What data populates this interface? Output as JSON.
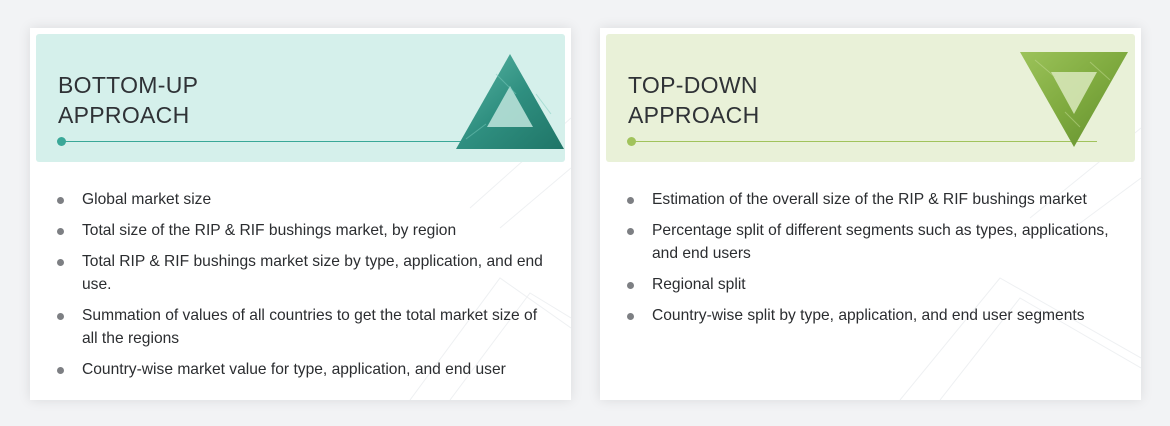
{
  "cards": [
    {
      "id": "bottom-up",
      "title": "BOTTOM-UP\nAPPROACH",
      "accent": "#3aa898",
      "header_bg": "#d5f0eb",
      "icon": "triangle-up-icon",
      "items": [
        "Global market size",
        "Total size of the RIP & RIF bushings market, by region",
        "Total RIP & RIF bushings market size by type, application, and end use.",
        "Summation of values of all countries to get the total market size of all the regions",
        "Country-wise market value for type, application, and end user"
      ]
    },
    {
      "id": "top-down",
      "title": "TOP-DOWN\nAPPROACH",
      "accent": "#a1c35c",
      "header_bg": "#e9f1d8",
      "icon": "triangle-down-icon",
      "items": [
        "Estimation of the overall size of the RIP & RIF bushings market",
        "Percentage split of different segments such as types, applications, and end users",
        "Regional split",
        "Country-wise split by type, application, and end user segments"
      ]
    }
  ]
}
